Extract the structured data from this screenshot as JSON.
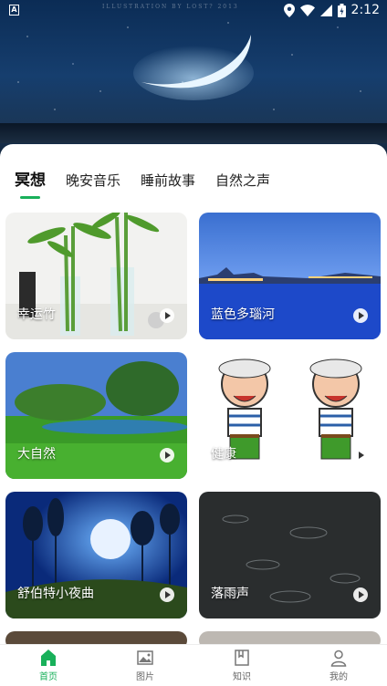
{
  "status_bar": {
    "time": "2:12",
    "left_icon": "a-icon"
  },
  "hero": {
    "watermark": "ILLUSTRATION BY LOST? 2013",
    "image": "night-sky-crescent-moon"
  },
  "tabs": [
    {
      "label": "冥想",
      "active": true
    },
    {
      "label": "晚安音乐",
      "active": false
    },
    {
      "label": "睡前故事",
      "active": false
    },
    {
      "label": "自然之声",
      "active": false
    }
  ],
  "cards": [
    {
      "title": "幸运竹",
      "image": "bamboo-plants"
    },
    {
      "title": "蓝色多瑙河",
      "image": "city-river-night"
    },
    {
      "title": "大自然",
      "image": "green-meadow-trees"
    },
    {
      "title": "健康",
      "image": "cartoon-grandpas"
    },
    {
      "title": "舒伯特小夜曲",
      "image": "moonlit-forest"
    },
    {
      "title": "落雨声",
      "image": "rain-drops"
    }
  ],
  "bottom_nav": [
    {
      "label": "首页",
      "icon": "home-icon",
      "active": true
    },
    {
      "label": "图片",
      "icon": "image-icon",
      "active": false
    },
    {
      "label": "知识",
      "icon": "book-icon",
      "active": false
    },
    {
      "label": "我的",
      "icon": "user-icon",
      "active": false
    }
  ],
  "colors": {
    "accent": "#18b05a"
  }
}
